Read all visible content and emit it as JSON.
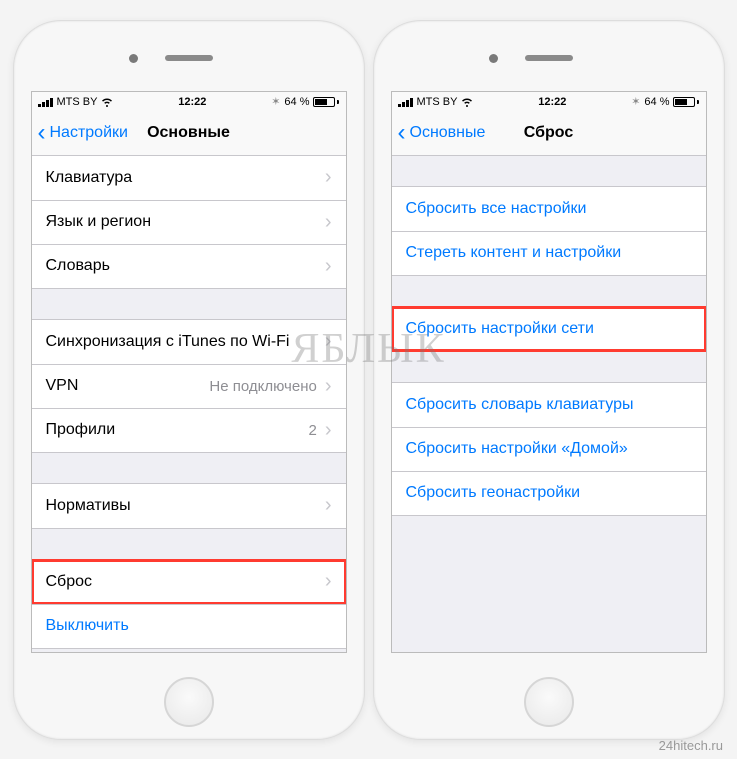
{
  "watermark": "ЯБЛЫК",
  "credit": "24hitech.ru",
  "status": {
    "carrier": "MTS BY",
    "time": "12:22",
    "battery": "64 %"
  },
  "phone1": {
    "back": "Настройки",
    "title": "Основные",
    "group1": [
      {
        "label": "Клавиатура"
      },
      {
        "label": "Язык и регион"
      },
      {
        "label": "Словарь"
      }
    ],
    "group2": [
      {
        "label": "Синхронизация с iTunes по Wi-Fi"
      },
      {
        "label": "VPN",
        "detail": "Не подключено"
      },
      {
        "label": "Профили",
        "detail": "2"
      }
    ],
    "group3": [
      {
        "label": "Нормативы"
      }
    ],
    "group4": [
      {
        "label": "Сброс",
        "highlight": true
      }
    ],
    "shutdown": "Выключить"
  },
  "phone2": {
    "back": "Основные",
    "title": "Сброс",
    "group1": [
      {
        "label": "Сбросить все настройки"
      },
      {
        "label": "Стереть контент и настройки"
      }
    ],
    "group2": [
      {
        "label": "Сбросить настройки сети",
        "highlight": true
      }
    ],
    "group3": [
      {
        "label": "Сбросить словарь клавиатуры"
      },
      {
        "label": "Сбросить настройки «Домой»"
      },
      {
        "label": "Сбросить геонастройки"
      }
    ]
  }
}
